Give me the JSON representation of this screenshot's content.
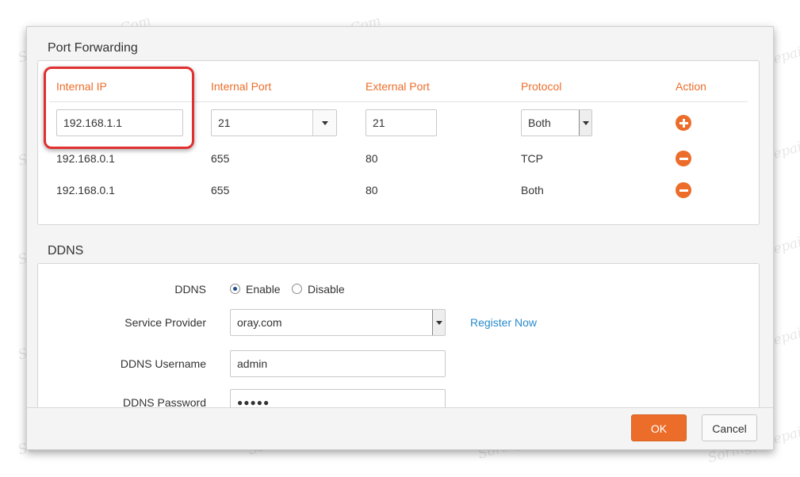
{
  "port_forwarding": {
    "title": "Port Forwarding",
    "headers": {
      "internal_ip": "Internal IP",
      "internal_port": "Internal Port",
      "external_port": "External Port",
      "protocol": "Protocol",
      "action": "Action"
    },
    "new_entry": {
      "internal_ip": "192.168.1.1",
      "internal_port": "21",
      "external_port": "21",
      "protocol": "Both"
    },
    "rows": [
      {
        "internal_ip": "192.168.0.1",
        "internal_port": "655",
        "external_port": "80",
        "protocol": "TCP"
      },
      {
        "internal_ip": "192.168.0.1",
        "internal_port": "655",
        "external_port": "80",
        "protocol": "Both"
      }
    ],
    "icons": {
      "add": "plus-circle-icon",
      "remove": "minus-circle-icon"
    }
  },
  "ddns": {
    "title": "DDNS",
    "ddns_label": "DDNS",
    "enable_label": "Enable",
    "disable_label": "Disable",
    "selected": "Enable",
    "service_provider_label": "Service Provider",
    "service_provider_value": "oray.com",
    "register_link": "Register Now",
    "username_label": "DDNS Username",
    "username_value": "admin",
    "password_label": "DDNS Password",
    "password_value": "●●●●●"
  },
  "footer": {
    "ok_label": "OK",
    "cancel_label": "Cancel"
  },
  "watermark_text": "Soringpcrepair.Com",
  "colors": {
    "accent": "#ec6d2a",
    "link": "#2a8ac9",
    "highlight": "#e03030"
  }
}
